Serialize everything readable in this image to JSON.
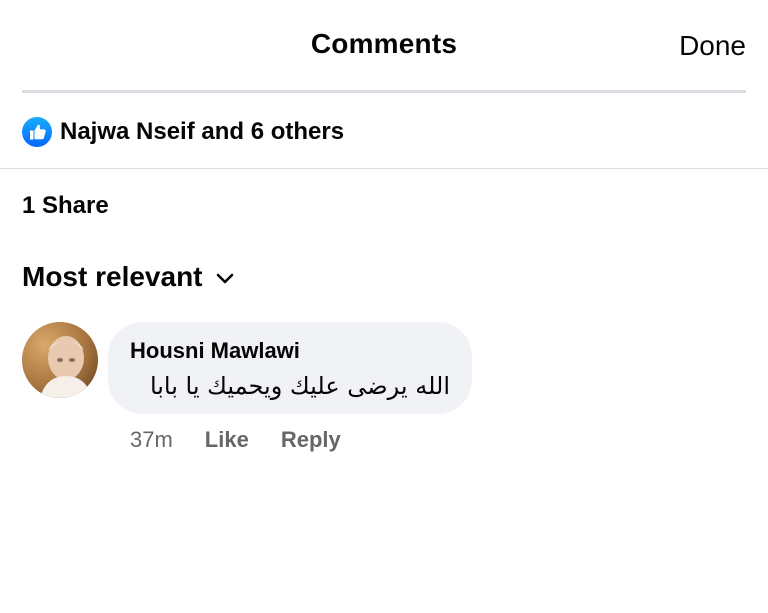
{
  "header": {
    "title": "Comments",
    "done_label": "Done"
  },
  "reactions": {
    "icon": "like-icon",
    "summary": "Najwa Nseif and 6 others",
    "accent_color": "#1877f2"
  },
  "shares": {
    "label": "1 Share"
  },
  "sort": {
    "label": "Most relevant",
    "icon": "chevron-down-icon"
  },
  "comments": [
    {
      "author": "Housni Mawlawi",
      "text": "الله يرضى عليك ويحميك يا بابا",
      "timestamp": "37m",
      "like_label": "Like",
      "reply_label": "Reply"
    }
  ]
}
